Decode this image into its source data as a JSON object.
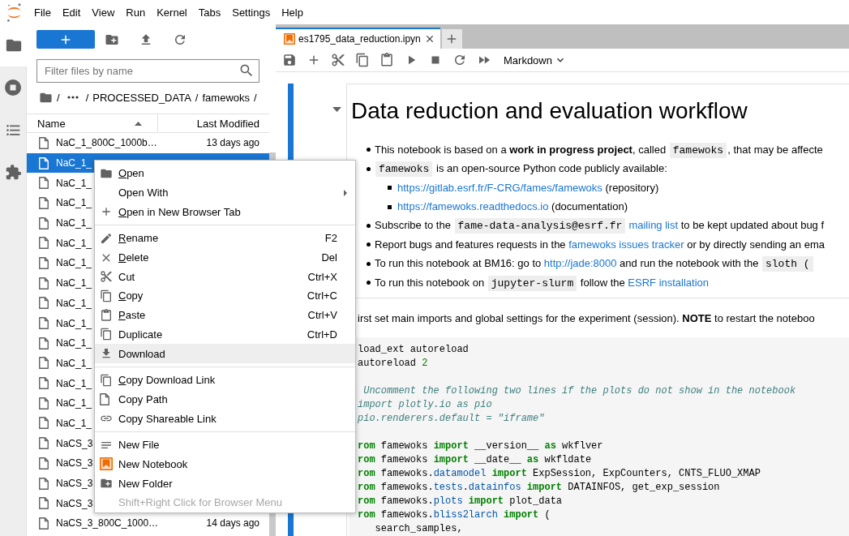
{
  "menubar": {
    "items": [
      "File",
      "Edit",
      "View",
      "Run",
      "Kernel",
      "Tabs",
      "Settings",
      "Help"
    ]
  },
  "left_sidebar": {
    "tabs": [
      {
        "selected": true
      },
      {
        "selected": false
      },
      {
        "selected": false
      },
      {
        "selected": false
      }
    ]
  },
  "file_browser": {
    "filter": {
      "placeholder": "Filter files by name"
    },
    "breadcrumbs": [
      {
        "kind": "home"
      },
      {
        "kind": "separator",
        "text": "/"
      },
      {
        "kind": "ellipsis"
      },
      {
        "kind": "separator",
        "text": "/"
      },
      {
        "kind": "crumb",
        "text": "PROCESSED_DATA"
      },
      {
        "kind": "separator",
        "text": "/"
      },
      {
        "kind": "crumb",
        "text": "famewoks"
      },
      {
        "kind": "separator",
        "text": "/"
      }
    ],
    "columns": [
      {
        "label": "Name",
        "sorted": true
      },
      {
        "label": "Last Modified",
        "sorted": false
      }
    ],
    "files": [
      {
        "name": "NaC_1_800C_1000b…",
        "modified": "13 days ago",
        "selected": false
      },
      {
        "name": "NaC_1_",
        "selected": true
      },
      {
        "name": "NaC_1_",
        "selected": false
      },
      {
        "name": "NaC_1_",
        "selected": false
      },
      {
        "name": "NaC_1_",
        "selected": false
      },
      {
        "name": "NaC_1_",
        "selected": false
      },
      {
        "name": "NaC_1_",
        "selected": false
      },
      {
        "name": "NaC_1_",
        "selected": false
      },
      {
        "name": "NaC_1_",
        "selected": false
      },
      {
        "name": "NaC_1_",
        "selected": false
      },
      {
        "name": "NaC_1_",
        "selected": false
      },
      {
        "name": "NaC_1_",
        "selected": false
      },
      {
        "name": "NaC_1_",
        "selected": false
      },
      {
        "name": "NaC_1_",
        "selected": false
      },
      {
        "name": "NaC_1_",
        "selected": false
      },
      {
        "name": "NaCS_3",
        "selected": false
      },
      {
        "name": "NaCS_3",
        "selected": false
      },
      {
        "name": "NaCS_3",
        "selected": false
      },
      {
        "name": "NaCS_3",
        "selected": false
      },
      {
        "name": "NaCS_3_800C_1000…",
        "modified": "14 days ago",
        "selected": false
      }
    ]
  },
  "context_menu": {
    "groups": [
      {
        "items": [
          {
            "label": "Open",
            "mnemonic": true,
            "submenu": false,
            "highlighted": false,
            "disabled": false
          },
          {
            "label": "Open With",
            "mnemonic": false,
            "submenu": true,
            "highlighted": false,
            "disabled": false
          },
          {
            "label": "Open in New Browser Tab",
            "mnemonic": true,
            "submenu": false,
            "highlighted": false,
            "disabled": false
          }
        ]
      },
      {
        "items": [
          {
            "label": "Rename",
            "shortcut": "F2",
            "mnemonic": true,
            "submenu": false,
            "highlighted": false,
            "disabled": false
          },
          {
            "label": "Delete",
            "shortcut": "Del",
            "mnemonic": true,
            "submenu": false,
            "highlighted": false,
            "disabled": false
          },
          {
            "label": "Cut",
            "shortcut": "Ctrl+X",
            "mnemonic": false,
            "submenu": false,
            "highlighted": false,
            "disabled": false
          },
          {
            "label": "Copy",
            "shortcut": "Ctrl+C",
            "mnemonic": true,
            "submenu": false,
            "highlighted": false,
            "disabled": false
          },
          {
            "label": "Paste",
            "shortcut": "Ctrl+V",
            "mnemonic": true,
            "submenu": false,
            "highlighted": false,
            "disabled": false
          },
          {
            "label": "Duplicate",
            "shortcut": "Ctrl+D",
            "mnemonic": false,
            "submenu": false,
            "highlighted": false,
            "disabled": false
          },
          {
            "label": "Download",
            "mnemonic": false,
            "submenu": false,
            "highlighted": true,
            "disabled": false
          }
        ]
      },
      {
        "items": [
          {
            "label": "Copy Download Link",
            "mnemonic": true,
            "submenu": false,
            "highlighted": false,
            "disabled": false
          },
          {
            "label": "Copy Path",
            "mnemonic": false,
            "submenu": false,
            "highlighted": false,
            "disabled": false
          },
          {
            "label": "Copy Shareable Link",
            "mnemonic": false,
            "submenu": false,
            "highlighted": false,
            "disabled": false
          }
        ]
      },
      {
        "items": [
          {
            "label": "New File",
            "mnemonic": false,
            "submenu": false,
            "highlighted": false,
            "disabled": false
          },
          {
            "label": "New Notebook",
            "mnemonic": false,
            "submenu": false,
            "highlighted": false,
            "disabled": false
          },
          {
            "label": "New Folder",
            "mnemonic": false,
            "submenu": false,
            "highlighted": false,
            "disabled": false
          },
          {
            "label": "Shift+Right Click for Browser Menu",
            "mnemonic": false,
            "submenu": false,
            "highlighted": false,
            "disabled": true
          }
        ]
      }
    ]
  },
  "notebook": {
    "tabs": [
      {
        "title": "es1795_data_reduction.ipyn",
        "selected": true
      }
    ],
    "cell_type": "Markdown",
    "cells": [
      {
        "kind": "markdown",
        "selected": true,
        "heading": {
          "text": "Data reduction and evaluation workflow",
          "expanded": true
        },
        "bullets": [
          {
            "segments": [
              {
                "kind": "text",
                "text": "This notebook is based on a **work in progress project**, called "
              },
              {
                "kind": "code",
                "text": "famewoks"
              },
              {
                "kind": "text",
                "text": ", that may be affecte"
              }
            ]
          },
          {
            "segments": [
              {
                "kind": "code",
                "text": "famewoks"
              },
              {
                "kind": "text",
                "text": " is an open-source Python code publicly available:"
              }
            ],
            "children": [
              {
                "segments": [
                  {
                    "kind": "link",
                    "text": "https://gitlab.esrf.fr/F-CRG/fames/famewoks"
                  },
                  {
                    "kind": "text",
                    "text": " (repository)"
                  }
                ]
              },
              {
                "segments": [
                  {
                    "kind": "link",
                    "text": "https://famewoks.readthedocs.io"
                  },
                  {
                    "kind": "text",
                    "text": " (documentation)"
                  }
                ]
              }
            ]
          },
          {
            "segments": [
              {
                "kind": "text",
                "text": "Subscribe to the "
              },
              {
                "kind": "code",
                "text": "fame-data-analysis@esrf.fr"
              },
              {
                "kind": "link",
                "text": "mailing list"
              },
              {
                "kind": "text",
                "text": " to be kept updated about bug f"
              }
            ]
          },
          {
            "segments": [
              {
                "kind": "text",
                "text": "Report bugs and features requests in the "
              },
              {
                "kind": "link",
                "text": "famewoks issues tracker"
              },
              {
                "kind": "text",
                "text": " or by directly sending an ema"
              }
            ]
          },
          {
            "segments": [
              {
                "kind": "text",
                "text": "To run this notebook at BM16: go to "
              },
              {
                "kind": "link",
                "text": "http://jade:8000"
              },
              {
                "kind": "text",
                "text": " and run the notebook with the "
              },
              {
                "kind": "code",
                "text": "sloth ("
              }
            ]
          },
          {
            "segments": [
              {
                "kind": "text",
                "text": "To run this notebook on "
              },
              {
                "kind": "code",
                "text": "jupyter-slurm"
              },
              {
                "kind": "text",
                "text": " follow the "
              },
              {
                "kind": "link",
                "text": "ESRF installation"
              }
            ]
          }
        ],
        "paragraph": [
          {
            "kind": "text",
            "text": "irst set main imports and global settings for the experiment (session). **NOTE** to restart the noteboo"
          }
        ],
        "code_blocks": [
          {
            "lines": [
              {
                "tokens": [
                  {
                    "kind": "plain",
                    "text": "load_ext autoreload"
                  }
                ]
              },
              {
                "tokens": [
                  {
                    "kind": "plain",
                    "text": "autoreload "
                  },
                  {
                    "kind": "number",
                    "text": "2"
                  }
                ]
              }
            ]
          },
          {
            "lines": [
              {
                "tokens": [
                  {
                    "kind": "comment",
                    "text": " Uncomment the following two lines if the plots do not show in the notebook"
                  }
                ]
              },
              {
                "tokens": [
                  {
                    "kind": "comment",
                    "text": "import plotly.io as pio"
                  }
                ]
              },
              {
                "tokens": [
                  {
                    "kind": "comment",
                    "text": "pio.renderers.default = \"iframe\""
                  }
                ]
              }
            ]
          },
          {
            "lines": [
              {
                "tokens": [
                  {
                    "kind": "keyword",
                    "text": "rom"
                  },
                  {
                    "kind": "plain",
                    "text": " famewoks "
                  },
                  {
                    "kind": "keyword",
                    "text": "import"
                  },
                  {
                    "kind": "plain",
                    "text": " __version__ "
                  },
                  {
                    "kind": "keyword",
                    "text": "as"
                  },
                  {
                    "kind": "plain",
                    "text": " wkflver"
                  }
                ]
              },
              {
                "tokens": [
                  {
                    "kind": "keyword",
                    "text": "rom"
                  },
                  {
                    "kind": "plain",
                    "text": " famewoks "
                  },
                  {
                    "kind": "keyword",
                    "text": "import"
                  },
                  {
                    "kind": "plain",
                    "text": " __date__ "
                  },
                  {
                    "kind": "keyword",
                    "text": "as"
                  },
                  {
                    "kind": "plain",
                    "text": " wkfldate"
                  }
                ]
              },
              {
                "tokens": [
                  {
                    "kind": "keyword",
                    "text": "rom"
                  },
                  {
                    "kind": "plain",
                    "text": " famewoks."
                  },
                  {
                    "kind": "module",
                    "text": "datamodel "
                  },
                  {
                    "kind": "keyword",
                    "text": "import"
                  },
                  {
                    "kind": "plain",
                    "text": " ExpSession, ExpCounters, CNTS_FLUO_XMAP"
                  }
                ]
              },
              {
                "tokens": [
                  {
                    "kind": "keyword",
                    "text": "rom"
                  },
                  {
                    "kind": "plain",
                    "text": " famewoks."
                  },
                  {
                    "kind": "module",
                    "text": "tests"
                  },
                  {
                    "kind": "plain",
                    "text": "."
                  },
                  {
                    "kind": "module",
                    "text": "datainfos "
                  },
                  {
                    "kind": "keyword",
                    "text": "import"
                  },
                  {
                    "kind": "plain",
                    "text": " DATAINFOS, get_exp_session"
                  }
                ]
              },
              {
                "tokens": [
                  {
                    "kind": "keyword",
                    "text": "rom"
                  },
                  {
                    "kind": "plain",
                    "text": " famewoks."
                  },
                  {
                    "kind": "module",
                    "text": "plots "
                  },
                  {
                    "kind": "keyword",
                    "text": "import"
                  },
                  {
                    "kind": "plain",
                    "text": " plot_data"
                  }
                ]
              },
              {
                "tokens": [
                  {
                    "kind": "keyword",
                    "text": "rom"
                  },
                  {
                    "kind": "plain",
                    "text": " famewoks."
                  },
                  {
                    "kind": "module",
                    "text": "bliss2larch "
                  },
                  {
                    "kind": "keyword",
                    "text": "import"
                  },
                  {
                    "kind": "plain",
                    "text": " ("
                  }
                ]
              },
              {
                "tokens": [
                  {
                    "kind": "plain",
                    "text": "   search_samples,"
                  }
                ]
              }
            ]
          }
        ]
      }
    ]
  }
}
